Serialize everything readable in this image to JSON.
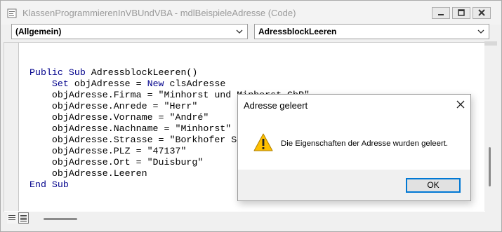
{
  "window": {
    "title": "KlassenProgrammierenInVBUndVBA - mdlBeispieleAdresse (Code)"
  },
  "toolbar": {
    "object_combo": "(Allgemein)",
    "procedure_combo": "AdressblockLeeren"
  },
  "code": {
    "lines": [
      "",
      "Public Sub AdressblockLeeren()",
      "    Set objAdresse = New clsAdresse",
      "    objAdresse.Firma = \"Minhorst und Minhorst GbR\"",
      "    objAdresse.Anrede = \"Herr\"",
      "    objAdresse.Vorname = \"André\"",
      "    objAdresse.Nachname = \"Minhorst\"",
      "    objAdresse.Strasse = \"Borkhofer S",
      "    objAdresse.PLZ = \"47137\"",
      "    objAdresse.Ort = \"Duisburg\"",
      "    objAdresse.Leeren",
      "End Sub"
    ]
  },
  "dialog": {
    "title": "Adresse geleert",
    "message": "Die Eigenschaften der Adresse wurden geleert.",
    "ok_label": "OK",
    "icon": "warning-icon"
  },
  "colors": {
    "keyword": "#00008b",
    "dialog_button_border": "#0078d4",
    "warning_fill": "#ffc000"
  }
}
